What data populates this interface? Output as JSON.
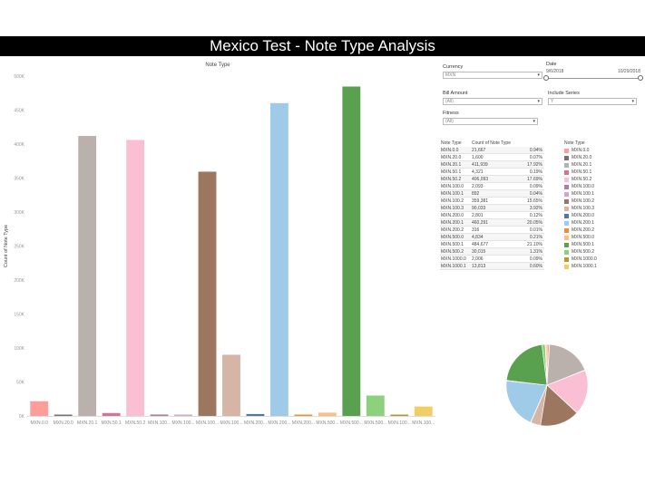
{
  "dashboard": {
    "title": "Mexico Test - Note Type Analysis"
  },
  "filters": {
    "currency": {
      "label": "Currency",
      "value": "MXN"
    },
    "date": {
      "label": "Date",
      "start": "9/6/2018",
      "end": "10/29/2018"
    },
    "bill_amount": {
      "label": "Bill Amount",
      "value": "(All)"
    },
    "include_series": {
      "label": "Include Series",
      "value": "Y"
    },
    "fitness": {
      "label": "Fitness",
      "value": "(All)"
    }
  },
  "table": {
    "headers": [
      "Note Type",
      "Count of Note Type",
      ""
    ],
    "rows": [
      [
        "MXN.0.0",
        "21,667",
        "0.94%"
      ],
      [
        "MXN.20.0",
        "1,600",
        "0.07%"
      ],
      [
        "MXN.20.1",
        "411,939",
        "17.92%"
      ],
      [
        "MXN.50.1",
        "4,321",
        "0.19%"
      ],
      [
        "MXN.50.2",
        "406,093",
        "17.69%"
      ],
      [
        "MXN.100.0",
        "2,093",
        "0.09%"
      ],
      [
        "MXN.100.1",
        "892",
        "0.04%"
      ],
      [
        "MXN.100.2",
        "359,381",
        "15.65%"
      ],
      [
        "MXN.100.3",
        "90,033",
        "3.92%"
      ],
      [
        "MXN.200.0",
        "2,801",
        "0.12%"
      ],
      [
        "MXN.200.1",
        "460,291",
        "20.05%"
      ],
      [
        "MXN.200.2",
        "316",
        "0.01%"
      ],
      [
        "MXN.500.0",
        "4,834",
        "0.21%"
      ],
      [
        "MXN.500.1",
        "484,677",
        "21.10%"
      ],
      [
        "MXN.500.2",
        "30,015",
        "1.31%"
      ],
      [
        "MXN.1000.0",
        "2,006",
        "0.09%"
      ],
      [
        "MXN.1000.1",
        "13,813",
        "0.60%"
      ]
    ]
  },
  "legend": {
    "title": "Note Type",
    "items": [
      {
        "label": "MXN.0.0",
        "color": "#ff9d9a"
      },
      {
        "label": "MXN.20.0",
        "color": "#79706e"
      },
      {
        "label": "MXN.20.1",
        "color": "#bab0ac"
      },
      {
        "label": "MXN.50.1",
        "color": "#d37295"
      },
      {
        "label": "MXN.50.2",
        "color": "#fabfd2"
      },
      {
        "label": "MXN.100.0",
        "color": "#b07aa1"
      },
      {
        "label": "MXN.100.1",
        "color": "#d4a6c8"
      },
      {
        "label": "MXN.100.2",
        "color": "#9d7660"
      },
      {
        "label": "MXN.100.3",
        "color": "#d7b5a6"
      },
      {
        "label": "MXN.200.0",
        "color": "#4e79a7"
      },
      {
        "label": "MXN.200.1",
        "color": "#a0cbe8"
      },
      {
        "label": "MXN.200.2",
        "color": "#f28e2b"
      },
      {
        "label": "MXN.500.0",
        "color": "#ffbe7d"
      },
      {
        "label": "MXN.500.1",
        "color": "#59a14f"
      },
      {
        "label": "MXN.500.2",
        "color": "#8cd17d"
      },
      {
        "label": "MXN.1000.0",
        "color": "#b6992d"
      },
      {
        "label": "MXN.1000.1",
        "color": "#f1ce63"
      }
    ]
  },
  "chart_data": {
    "type": "bar",
    "title": "Note Type",
    "ylabel": "Count of Note Type",
    "ylim": [
      0,
      500000
    ],
    "yticks": [
      0,
      50000,
      100000,
      150000,
      200000,
      250000,
      300000,
      350000,
      400000,
      450000,
      500000
    ],
    "ytick_labels": [
      "0K",
      "50K",
      "100K",
      "150K",
      "200K",
      "250K",
      "300K",
      "350K",
      "400K",
      "450K",
      "500K"
    ],
    "categories": [
      "MXN.0.0",
      "MXN.20.0",
      "MXN.20.1",
      "MXN.50.1",
      "MXN.50.2",
      "MXN.100.0",
      "MXN.100.1",
      "MXN.100.2",
      "MXN.100.3",
      "MXN.200.0",
      "MXN.200.1",
      "MXN.200.2",
      "MXN.500.0",
      "MXN.500.1",
      "MXN.500.2",
      "MXN.1000.0",
      "MXN.1000.1"
    ],
    "tick_labels": [
      "MXN.0.0",
      "MXN.20.0",
      "MXN.20.1",
      "MXN.50.1",
      "MXN.50.2",
      "MXN.100...",
      "MXN.100...",
      "MXN.100...",
      "MXN.100...",
      "MXN.200...",
      "MXN.200...",
      "MXN.200...",
      "MXN.500...",
      "MXN.500...",
      "MXN.500...",
      "MXN.100...",
      "MXN.100..."
    ],
    "values": [
      21667,
      1600,
      411939,
      4321,
      406093,
      2093,
      892,
      359381,
      90033,
      2801,
      460291,
      316,
      4834,
      484677,
      30015,
      2006,
      13813
    ],
    "grid": false,
    "pie": {
      "type": "pie",
      "categories": [
        "MXN.0.0",
        "MXN.20.0",
        "MXN.20.1",
        "MXN.50.1",
        "MXN.50.2",
        "MXN.100.0",
        "MXN.100.1",
        "MXN.100.2",
        "MXN.100.3",
        "MXN.200.0",
        "MXN.200.1",
        "MXN.200.2",
        "MXN.500.0",
        "MXN.500.1",
        "MXN.500.2",
        "MXN.1000.0",
        "MXN.1000.1"
      ],
      "values": [
        0.94,
        0.07,
        17.92,
        0.19,
        17.69,
        0.09,
        0.04,
        15.65,
        3.92,
        0.12,
        20.05,
        0.01,
        0.21,
        21.1,
        1.31,
        0.09,
        0.6
      ]
    }
  }
}
